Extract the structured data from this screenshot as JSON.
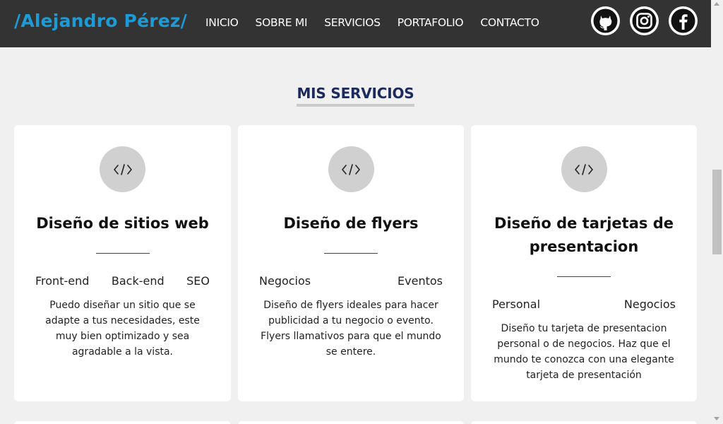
{
  "brand": "/Alejandro Pérez/",
  "nav": [
    "INICIO",
    "SOBRE MI",
    "SERVICIOS",
    "PORTAFOLIO",
    "CONTACTO"
  ],
  "socials": [
    {
      "icon": "github-icon"
    },
    {
      "icon": "instagram-icon"
    },
    {
      "icon": "facebook-icon"
    }
  ],
  "section_title": "MIS SERVICIOS",
  "cards": [
    {
      "icon": "code-icon",
      "title": "Diseño de sitios web",
      "tags": [
        "Front-end",
        "Back-end",
        "SEO"
      ],
      "description": "Puedo diseñar un sitio que se adapte a tus necesidades, este muy bien optimizado y sea agradable a la vista."
    },
    {
      "icon": "code-icon",
      "title": "Diseño de flyers",
      "tags": [
        "Negocios",
        "Eventos"
      ],
      "description": "Diseño de flyers ideales para hacer publicidad a tu negocio o evento. Flyers llamativos para que el mundo se entere."
    },
    {
      "icon": "code-icon",
      "title": "Diseño de tarjetas de presentacion",
      "tags": [
        "Personal",
        "Negocios"
      ],
      "description": "Diseño tu tarjeta de presentacion personal o de negocios. Haz que el mundo te conozca con una elegante tarjeta de presentación"
    }
  ],
  "colors": {
    "navbar": "#333333",
    "brand": "#1d9bd6",
    "title": "#1d2a5e",
    "background": "#f0f0f0"
  }
}
